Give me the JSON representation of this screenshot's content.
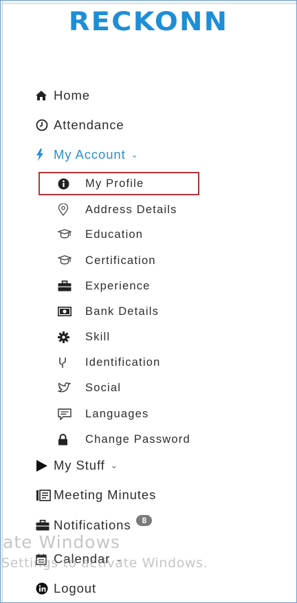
{
  "brand": {
    "logo_text": "RECKONN",
    "color": "#1e8ed6"
  },
  "nav": {
    "home": {
      "label": "Home",
      "icon": "home-icon"
    },
    "attendance": {
      "label": "Attendance",
      "icon": "clock-icon"
    },
    "my_account": {
      "label": "My Account",
      "icon": "bolt-icon",
      "expanded": true,
      "items": [
        {
          "label": "My Profile",
          "icon": "info-circle-icon",
          "selected": true
        },
        {
          "label": "Address Details",
          "icon": "map-pin-icon"
        },
        {
          "label": "Education",
          "icon": "graduation-cap-icon"
        },
        {
          "label": "Certification",
          "icon": "graduation-cap-icon"
        },
        {
          "label": "Experience",
          "icon": "briefcase-icon"
        },
        {
          "label": "Bank Details",
          "icon": "money-icon"
        },
        {
          "label": "Skill",
          "icon": "gear-icon"
        },
        {
          "label": "Identification",
          "icon": "fingerprint-icon"
        },
        {
          "label": "Social",
          "icon": "twitter-icon"
        },
        {
          "label": "Languages",
          "icon": "chat-icon"
        },
        {
          "label": "Change Password",
          "icon": "lock-icon"
        }
      ]
    },
    "my_stuff": {
      "label": "My Stuff",
      "icon": "play-icon"
    },
    "meeting_minutes": {
      "label": "Meeting Minutes",
      "icon": "notebook-icon"
    },
    "notifications": {
      "label": "Notifications",
      "icon": "briefcase-icon",
      "badge": "8"
    },
    "calendar": {
      "label": "Calendar",
      "icon": "calendar-icon"
    },
    "logout": {
      "label": "Logout",
      "icon": "linkedin-icon"
    }
  },
  "watermark": {
    "line1": "ate Windows",
    "line2": "Settings to activate Windows."
  },
  "colors": {
    "accent": "#2a8fd4",
    "selected_border": "#b7323a",
    "badge_bg": "#7a7a7a"
  }
}
